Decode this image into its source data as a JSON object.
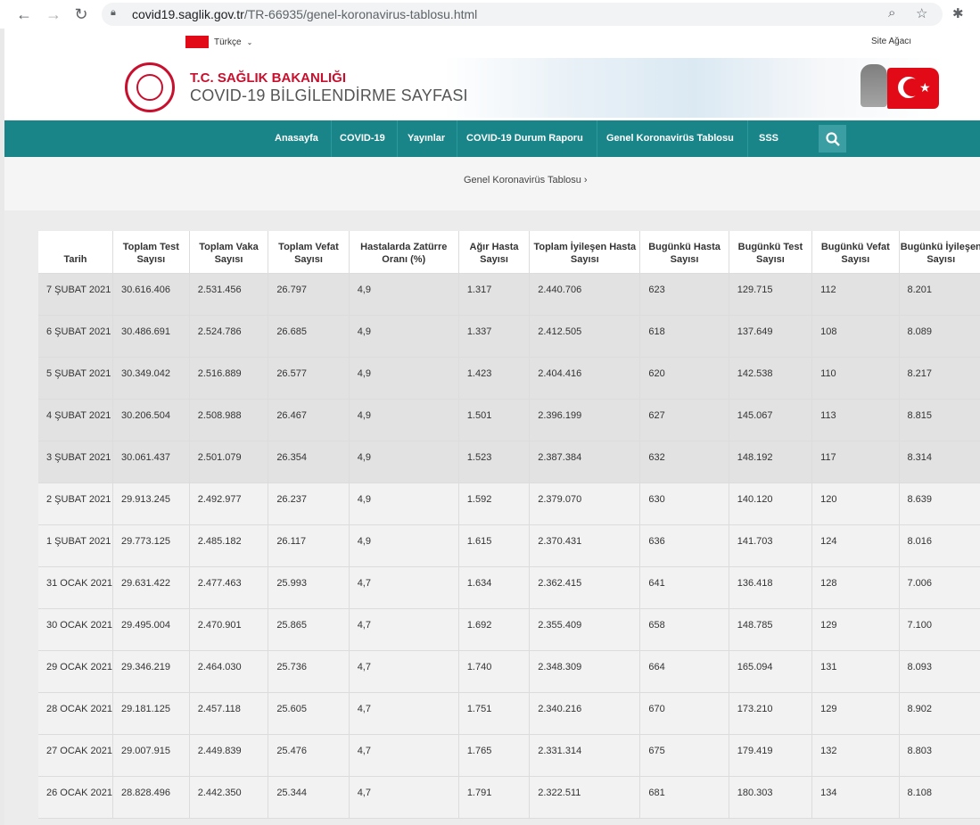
{
  "browser": {
    "url_host": "covid19.saglik.gov.tr",
    "url_path": "/TR-66935/genel-koronavirus-tablosu.html"
  },
  "topbar": {
    "language": "Türkçe",
    "sitemap": "Site Ağacı"
  },
  "header": {
    "ministry": "T.C. SAĞLIK BAKANLIĞI",
    "subtitle": "COVID-19 BİLGİLENDİRME SAYFASI"
  },
  "nav": {
    "items": [
      "Anasayfa",
      "COVID-19",
      "Yayınlar",
      "COVID-19 Durum Raporu",
      "Genel Koronavirüs Tablosu",
      "SSS"
    ]
  },
  "breadcrumb": "Genel Koronavirüs Tablosu ›",
  "table": {
    "headers": [
      "Tarih",
      "Toplam Test Sayısı",
      "Toplam Vaka Sayısı",
      "Toplam Vefat Sayısı",
      "Hastalarda Zatürre Oranı (%)",
      "Ağır Hasta Sayısı",
      "Toplam İyileşen Hasta Sayısı",
      "Bugünkü Hasta Sayısı",
      "Bugünkü Test Sayısı",
      "Bugünkü Vefat Sayısı",
      "Bugünkü İyileşen Sayısı"
    ],
    "rows": [
      [
        "7 ŞUBAT 2021",
        "30.616.406",
        "2.531.456",
        "26.797",
        "4,9",
        "1.317",
        "2.440.706",
        "623",
        "129.715",
        "112",
        "8.201"
      ],
      [
        "6 ŞUBAT 2021",
        "30.486.691",
        "2.524.786",
        "26.685",
        "4,9",
        "1.337",
        "2.412.505",
        "618",
        "137.649",
        "108",
        "8.089"
      ],
      [
        "5 ŞUBAT 2021",
        "30.349.042",
        "2.516.889",
        "26.577",
        "4,9",
        "1.423",
        "2.404.416",
        "620",
        "142.538",
        "110",
        "8.217"
      ],
      [
        "4 ŞUBAT 2021",
        "30.206.504",
        "2.508.988",
        "26.467",
        "4,9",
        "1.501",
        "2.396.199",
        "627",
        "145.067",
        "113",
        "8.815"
      ],
      [
        "3 ŞUBAT 2021",
        "30.061.437",
        "2.501.079",
        "26.354",
        "4,9",
        "1.523",
        "2.387.384",
        "632",
        "148.192",
        "117",
        "8.314"
      ],
      [
        "2 ŞUBAT 2021",
        "29.913.245",
        "2.492.977",
        "26.237",
        "4,9",
        "1.592",
        "2.379.070",
        "630",
        "140.120",
        "120",
        "8.639"
      ],
      [
        "1 ŞUBAT 2021",
        "29.773.125",
        "2.485.182",
        "26.117",
        "4,9",
        "1.615",
        "2.370.431",
        "636",
        "141.703",
        "124",
        "8.016"
      ],
      [
        "31 OCAK 2021",
        "29.631.422",
        "2.477.463",
        "25.993",
        "4,7",
        "1.634",
        "2.362.415",
        "641",
        "136.418",
        "128",
        "7.006"
      ],
      [
        "30 OCAK 2021",
        "29.495.004",
        "2.470.901",
        "25.865",
        "4,7",
        "1.692",
        "2.355.409",
        "658",
        "148.785",
        "129",
        "7.100"
      ],
      [
        "29 OCAK 2021",
        "29.346.219",
        "2.464.030",
        "25.736",
        "4,7",
        "1.740",
        "2.348.309",
        "664",
        "165.094",
        "131",
        "8.093"
      ],
      [
        "28 OCAK 2021",
        "29.181.125",
        "2.457.118",
        "25.605",
        "4,7",
        "1.751",
        "2.340.216",
        "670",
        "173.210",
        "129",
        "8.902"
      ],
      [
        "27 OCAK 2021",
        "29.007.915",
        "2.449.839",
        "25.476",
        "4,7",
        "1.765",
        "2.331.314",
        "675",
        "179.419",
        "132",
        "8.803"
      ],
      [
        "26 OCAK 2021",
        "28.828.496",
        "2.442.350",
        "25.344",
        "4,7",
        "1.791",
        "2.322.511",
        "681",
        "180.303",
        "134",
        "8.108"
      ]
    ]
  }
}
